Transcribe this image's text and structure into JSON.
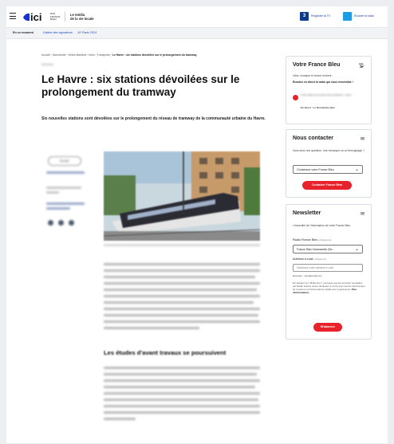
{
  "header": {
    "logo_text": "ici",
    "logo_small": "PAR FRANCE BLEU",
    "tagline_line1": "Le média",
    "tagline_line2": "de la vie locale",
    "tv_badge": "3",
    "tv_link": "Regarder la TV",
    "radio_link": "Écouter la radio"
  },
  "subnav": {
    "label": "En ce moment",
    "links": [
      "Galère des signaleurs",
      "JO Paris 2024"
    ]
  },
  "article": {
    "breadcrumb": "Accueil › Normandie › Seine-Maritime › Infos › Transports ›",
    "breadcrumb_current": "Le Havre : six stations dévoilées sur le prolongement du tramway",
    "kicker": "Nouvelles",
    "title": "Le Havre : six stations dévoilées sur le prolongement du tramway",
    "lead": "Six nouvelles stations sont dévoilées sur le prolongement du réseau de tramway de la communauté urbaine du Havre.",
    "listen_label": "Écouter",
    "section_heading": "Les études d'avant travaux se poursuivent"
  },
  "sidebar": {
    "france_bleu": {
      "title": "Votre France Bleu",
      "line1": "Infos, musique et bonne humeur...",
      "line2": "Écoutez en direct la radio qui vous ressemble !",
      "station": "France Bleu Normandie (Seine-Maritime - Eure)",
      "now": "En direct : Le Normandie Quiz"
    },
    "contact": {
      "title": "Nous contacter",
      "text": "Vous avez une question, une remarque ou un témoignage ?",
      "select_value": "Choisissez votre France Bleu",
      "button": "Contacter France Bleu"
    },
    "newsletter": {
      "title": "Newsletter",
      "text": "L'essentiel de l'information de votre France Bleu.",
      "radio_label": "Radio France Bleu",
      "radio_hint": "(obligatoire)",
      "radio_value": "France Bleu Normandie (Se...",
      "email_label": "Adresse e-mail",
      "email_hint": "(obligatoire)",
      "email_placeholder": "Saisissez votre adresse e-mail",
      "example": "Exemple : nom@email.com",
      "legal": "En cliquant sur \"M'abonner\", j'accepte que les données recueillies par Radio France soient destinées à l'envoi par courrier électronique de contenus et d'informations relatifs aux programmes.",
      "legal_link": "Plus d'informations",
      "button": "M'abonner"
    }
  },
  "colors": {
    "brand_red": "#e8222a",
    "link_blue": "#1f48b8",
    "tv_navy": "#0b3a8c"
  }
}
